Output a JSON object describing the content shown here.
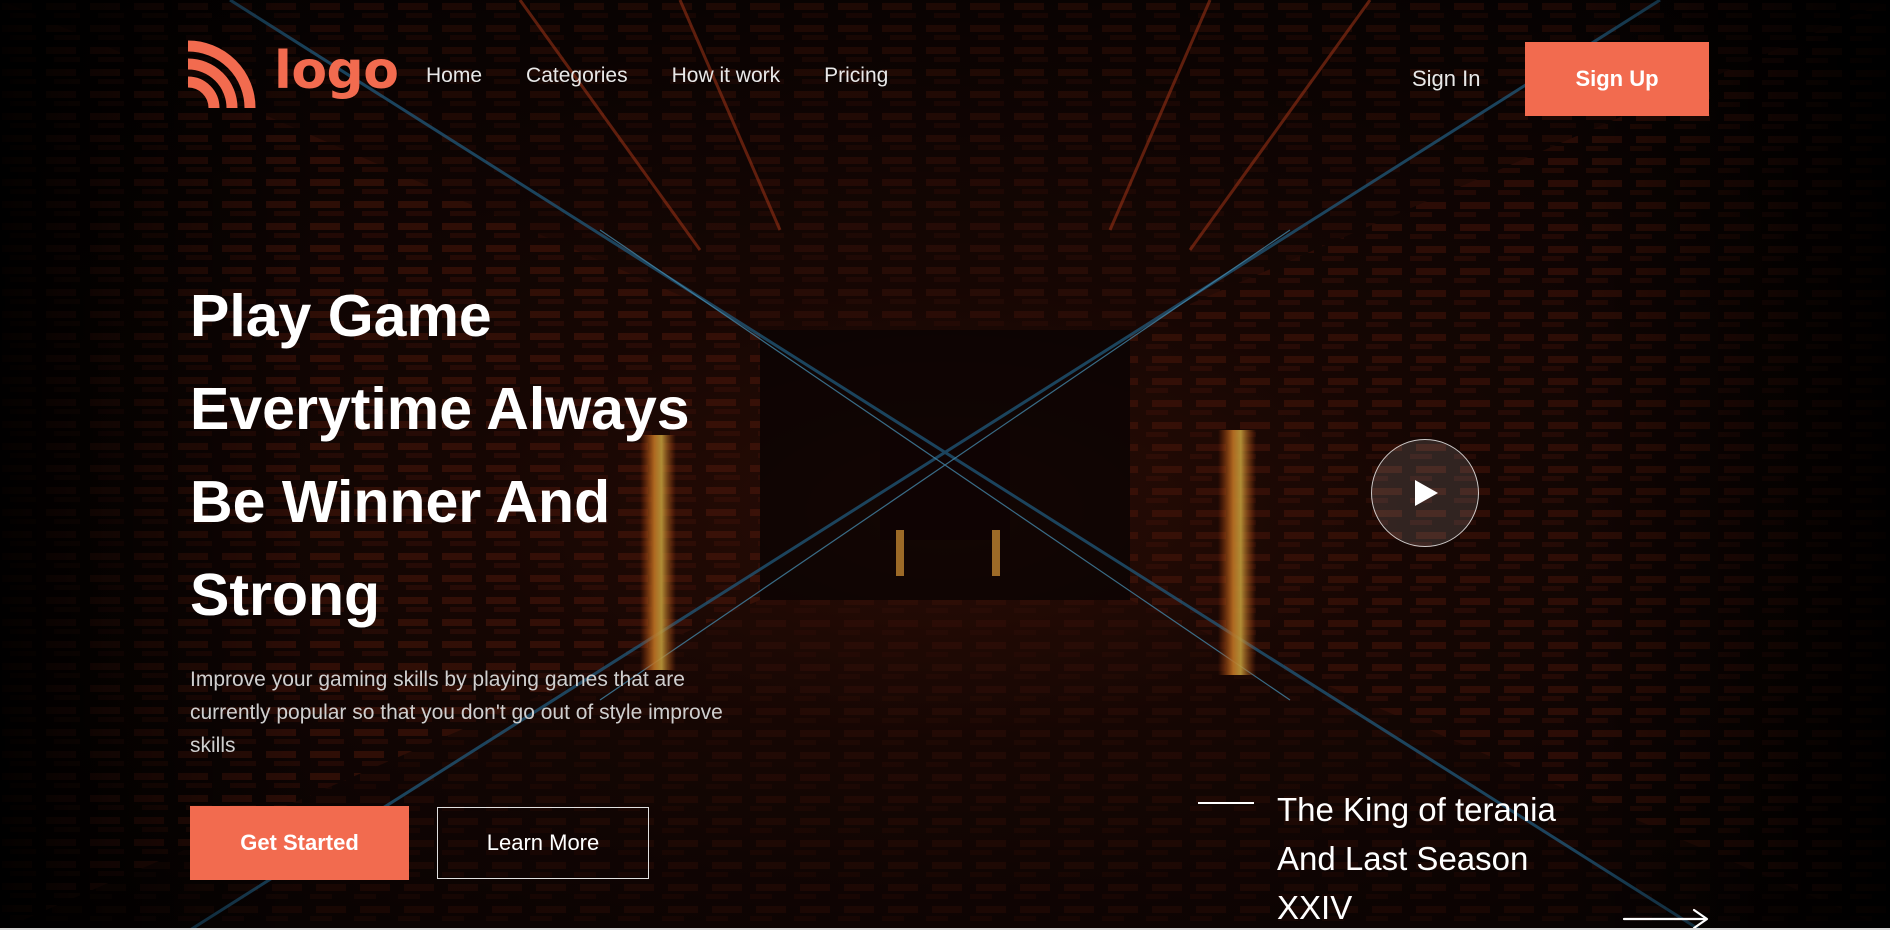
{
  "brand": {
    "logo_text": "logo",
    "accent_color": "#f26b4f",
    "logo_icon": "signal-arcs-icon"
  },
  "nav": {
    "items": [
      {
        "label": "Home"
      },
      {
        "label": "Categories"
      },
      {
        "label": "How it work"
      },
      {
        "label": "Pricing"
      }
    ],
    "sign_in": "Sign In",
    "sign_up": "Sign Up"
  },
  "hero": {
    "title_lines": [
      "Play Game",
      "Everytime Always",
      "Be Winner And",
      "Strong"
    ],
    "description": "Improve your gaming skills by playing games that are currently popular so that you don't go out of style improve skills",
    "primary_button": "Get Started",
    "secondary_button": "Learn More"
  },
  "feature": {
    "title_lines": [
      "The King of terania",
      "And Last Season",
      "XXIV"
    ],
    "play_icon": "play-icon",
    "arrow_icon": "arrow-right-icon"
  }
}
